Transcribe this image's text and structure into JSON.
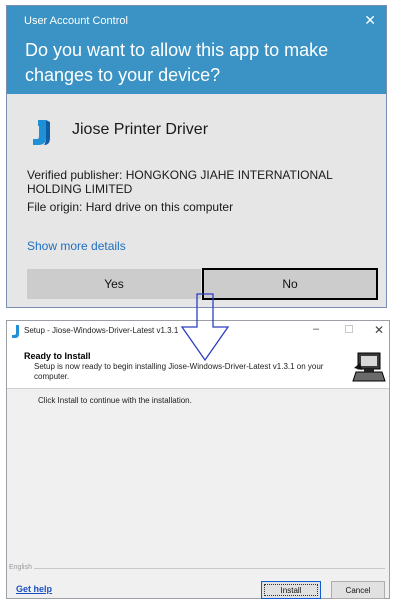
{
  "uac": {
    "caption": "User Account Control",
    "close_glyph": "✕",
    "question": "Do you want to allow this app to make changes to your device?",
    "app_icon": "jiose-logo-icon",
    "app_name": "Jiose Printer Driver",
    "publisher": "Verified publisher: HONGKONG JIAHE INTERNATIONAL HOLDING LIMITED",
    "origin": "File origin: Hard drive on this computer",
    "more_details": "Show more details",
    "yes_label": "Yes",
    "no_label": "No",
    "colors": {
      "header": "#3a93c4",
      "body": "#e6e6e6",
      "link": "#1e6fbf"
    }
  },
  "setup": {
    "title": "Setup - Jiose-Windows-Driver-Latest v1.3.1",
    "min_glyph": "–",
    "close_glyph": "✕",
    "ready_title": "Ready to Install",
    "ready_desc": "Setup is now ready to begin installing Jiose-Windows-Driver-Latest v1.3.1 on your computer.",
    "instruction": "Click Install to continue with the installation.",
    "language": "English",
    "get_help": "Get help",
    "install_label": "Install",
    "cancel_label": "Cancel",
    "wizard_icon": "setup-wizard-computer-icon"
  },
  "annotation": {
    "arrow_icon": "down-arrow-icon",
    "arrow_color": "#2f3fc0"
  }
}
